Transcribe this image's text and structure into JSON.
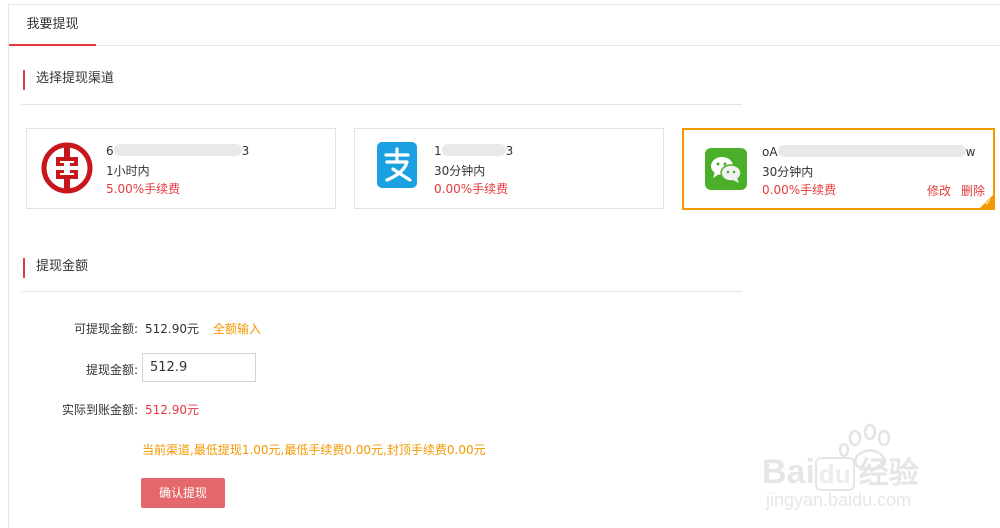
{
  "tab": {
    "label": "我要提现"
  },
  "channel_section": {
    "title": "选择提现渠道"
  },
  "channels": [
    {
      "icon": "icbc-bank-icon",
      "account": "6",
      "account_end": "3",
      "time": "1小时内",
      "fee": "5.00%手续费"
    },
    {
      "icon": "alipay-icon",
      "account": "1",
      "account_end": "3",
      "time": "30分钟内",
      "fee": "0.00%手续费"
    },
    {
      "icon": "wechat-icon",
      "account": "oA",
      "account_end": "w",
      "time": "30分钟内",
      "fee": "0.00%手续费",
      "edit_label": "修改",
      "delete_label": "删除",
      "selected": true
    }
  ],
  "amount_section": {
    "title": "提现金额"
  },
  "form": {
    "available_label": "可提现金额:",
    "available_value": "512.90元",
    "fill_all_label": "全额输入",
    "amount_label": "提现金额:",
    "amount_value": "512.9",
    "actual_label": "实际到账金额:",
    "actual_value": "512.90元",
    "tip": "当前渠道,最低提现1.00元,最低手续费0.00元,封顶手续费0.00元",
    "submit_label": "确认提现"
  },
  "watermark": {
    "brand_a": "Bai",
    "brand_b": "du",
    "brand_c": "经验",
    "url": "jingyan.baidu.com"
  },
  "colors": {
    "accent": "#e4393c",
    "selected_border": "#f39800",
    "tip": "#f39800",
    "button": "#e4686b"
  }
}
